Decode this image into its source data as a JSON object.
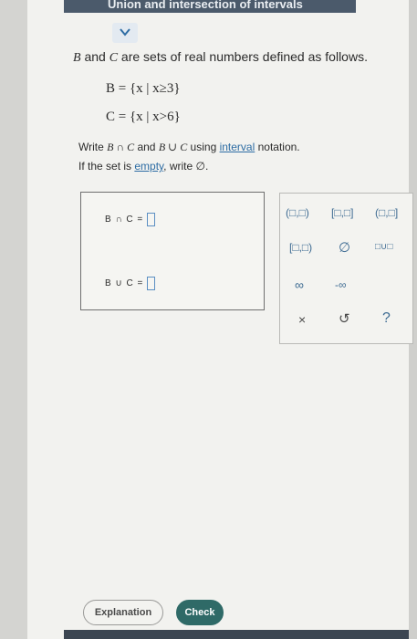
{
  "header": {
    "title": "Union and intersection of intervals"
  },
  "problem": {
    "prompt_pre": " and ",
    "var_b": "B",
    "var_c": "C",
    "prompt_post": " are sets of real numbers defined as follows.",
    "set_b": "B = {x | x≥3}",
    "set_c": "C = {x | x>6}",
    "instr_write": "Write ",
    "instr_intersect_expr": "B ∩ C",
    "instr_and": " and ",
    "instr_union_expr": "B ∪ C",
    "instr_using": " using ",
    "instr_link": "interval",
    "instr_end": " notation.",
    "empty_pre": "If the set is ",
    "empty_link": "empty",
    "empty_post": ", write ∅."
  },
  "answers": {
    "intersection_label": "B ∩ C =",
    "union_label": "B ∪ C ="
  },
  "keypad": {
    "open_open": "(□,□)",
    "closed_closed": "[□,□]",
    "open_closed": "(□,□]",
    "closed_open": "[□,□)",
    "empty_set": "∅",
    "union": "□∪□",
    "infinity": "∞",
    "neg_infinity": "-∞",
    "clear": "×",
    "undo": "↺",
    "help": "?"
  },
  "buttons": {
    "explanation": "Explanation",
    "check": "Check"
  },
  "colors": {
    "header": "#4b5a6b",
    "check_button": "#2f6a67",
    "link": "#2e6da4",
    "keypad_text": "#3f6c93"
  }
}
